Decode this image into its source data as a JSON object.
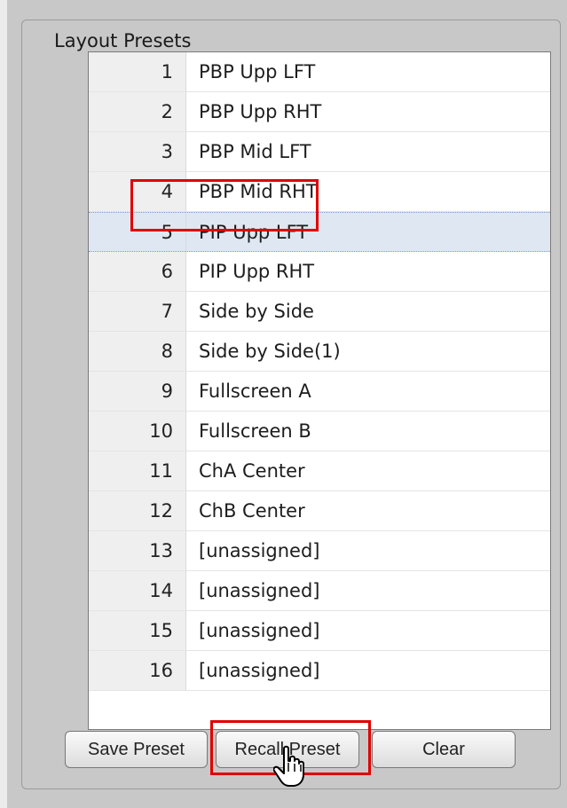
{
  "group": {
    "title": "Layout Presets"
  },
  "presets": [
    {
      "num": "1",
      "name": "PBP Upp LFT"
    },
    {
      "num": "2",
      "name": "PBP Upp RHT"
    },
    {
      "num": "3",
      "name": "PBP Mid LFT"
    },
    {
      "num": "4",
      "name": "PBP Mid RHT"
    },
    {
      "num": "5",
      "name": "PIP Upp LFT",
      "selected": true
    },
    {
      "num": "6",
      "name": "PIP Upp RHT"
    },
    {
      "num": "7",
      "name": "Side by Side"
    },
    {
      "num": "8",
      "name": "Side by Side(1)"
    },
    {
      "num": "9",
      "name": "Fullscreen A"
    },
    {
      "num": "10",
      "name": "Fullscreen B"
    },
    {
      "num": "11",
      "name": "ChA Center"
    },
    {
      "num": "12",
      "name": "ChB Center"
    },
    {
      "num": "13",
      "name": "[unassigned]"
    },
    {
      "num": "14",
      "name": "[unassigned]"
    },
    {
      "num": "15",
      "name": "[unassigned]"
    },
    {
      "num": "16",
      "name": "[unassigned]"
    }
  ],
  "buttons": {
    "save": "Save Preset",
    "recall": "Recall Preset",
    "clear": "Clear"
  },
  "colors": {
    "highlight": "#e00000",
    "selection": "#dfe7f2"
  }
}
